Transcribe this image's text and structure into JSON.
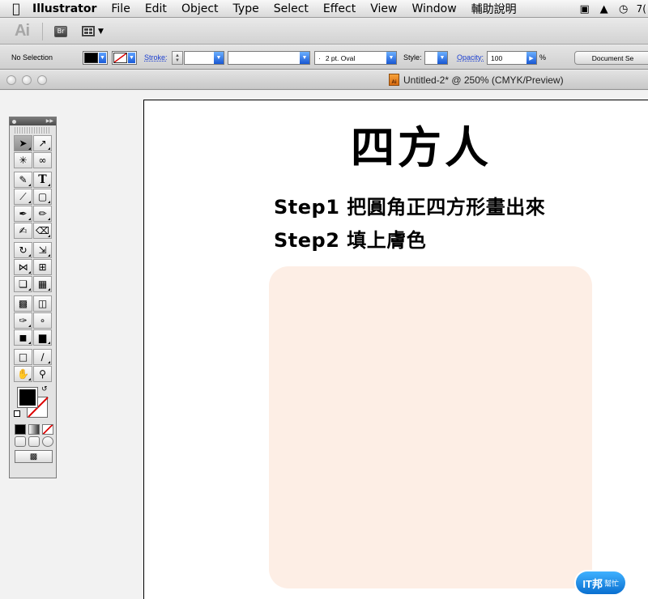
{
  "menubar": {
    "apple_icon": "apple-logo-icon",
    "app_name": "Illustrator",
    "items": [
      "File",
      "Edit",
      "Object",
      "Type",
      "Select",
      "Effect",
      "View",
      "Window",
      "輔助說明"
    ],
    "tray_text": "7("
  },
  "appbar": {
    "logo_text": "Ai",
    "bridge_label": "Br"
  },
  "control_panel": {
    "selection_label": "No Selection",
    "fill_color": "#000000",
    "stroke_label": "Stroke:",
    "stroke_weight": "",
    "brush_value": "",
    "brush_definition": "2 pt. Oval",
    "style_label": "Style:",
    "opacity_label": "Opacity:",
    "opacity_value": "100",
    "opacity_unit": "%",
    "document_setup": "Document Se"
  },
  "document": {
    "title": "Untitled-2* @ 250% (CMYK/Preview)"
  },
  "artwork": {
    "title": "四方人",
    "step1": "Step1 把圓角正四方形畫出來",
    "step2": "Step2 填上膚色",
    "skin_color": "#fdeee5"
  },
  "tools": {
    "fill_color": "#000000",
    "stroke_color": "#ffffff"
  },
  "watermark": {
    "text": "IT邦",
    "sub": "幫忙"
  }
}
